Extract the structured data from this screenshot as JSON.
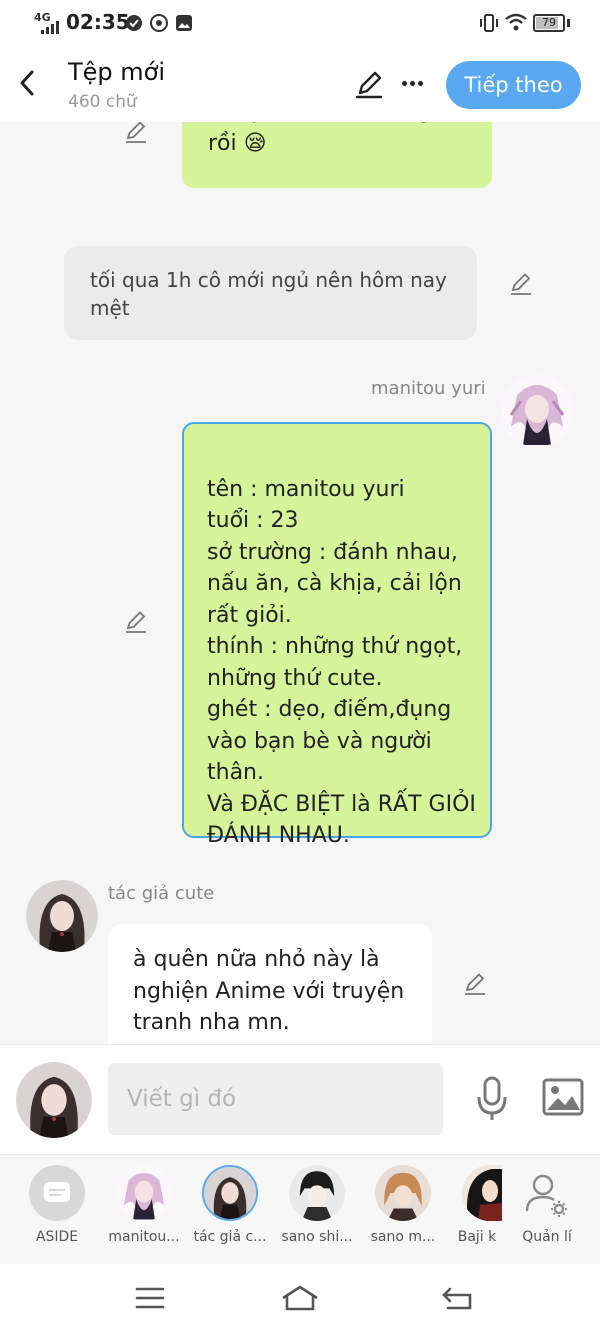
{
  "status_bar": {
    "network": "4G",
    "time": "02:35",
    "battery": "79"
  },
  "header": {
    "title": "Tệp mới",
    "subtitle": "460 chữ",
    "next_label": "Tiếp theo"
  },
  "messages": {
    "m1": {
      "text": "tối qua lại thức khuya rồi 😪"
    },
    "m2": {
      "text": "tối qua 1h cô mới ngủ nên hôm nay mệt"
    },
    "m3": {
      "sender": "manitou yuri",
      "text": "tên : manitou yuri\ntuổi : 23\nsở trường : đánh nhau, nấu ăn, cà khịa, cải lộn rất giỏi.\nthính : những thứ ngọt, những thứ cute.\nghét : dẹo, điếm,đụng vào bạn bè và người thân.\nVà ĐẶC BIỆT là RẤT GIỎI ĐÁNH NHAU."
    },
    "m4": {
      "sender": "tác giả cute",
      "text": "à quên nữa nhỏ này là nghiện Anime với truyện tranh nha mn."
    }
  },
  "compose": {
    "placeholder": "Viết gì đó"
  },
  "characters": [
    {
      "label": "ASIDE"
    },
    {
      "label": "manitou..."
    },
    {
      "label": "tác giả c..."
    },
    {
      "label": "sano shi..."
    },
    {
      "label": "sano m..."
    },
    {
      "label": "Baji k"
    },
    {
      "label": "Quản lí"
    }
  ],
  "colors": {
    "accent": "#5aa9f0",
    "bubble_green": "#d6f49a",
    "bubble_border": "#4aa6e6",
    "bubble_gray": "#ebebeb"
  }
}
